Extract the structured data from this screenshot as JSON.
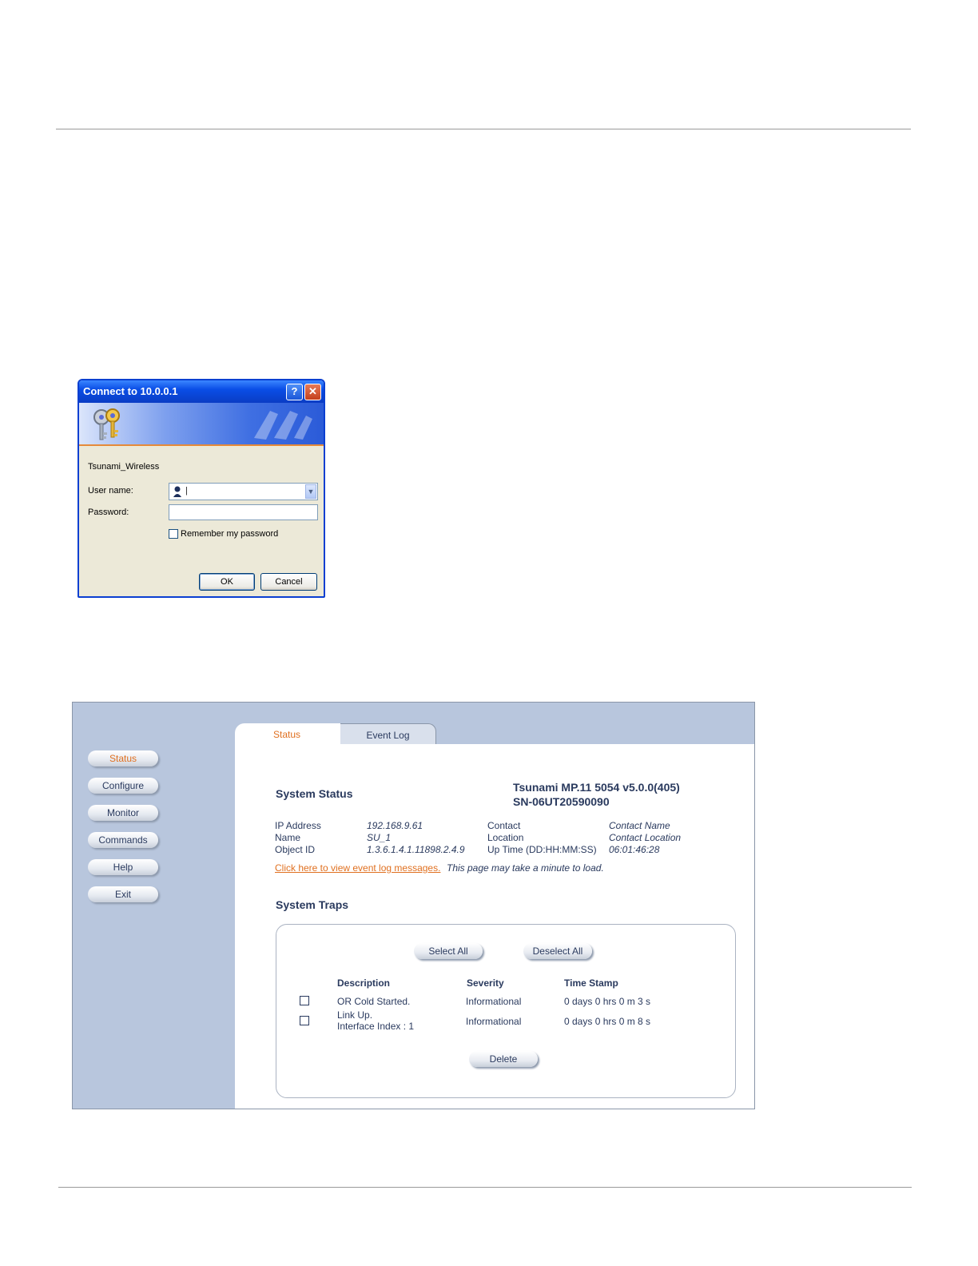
{
  "dialog": {
    "title": "Connect to 10.0.0.1",
    "realm": "Tsunami_Wireless",
    "username_label": "User name:",
    "username_value": "|",
    "password_label": "Password:",
    "password_value": "",
    "remember_label": "Remember my password",
    "ok_label": "OK",
    "cancel_label": "Cancel",
    "help_glyph": "?",
    "close_glyph": "✕"
  },
  "web": {
    "tabs": [
      {
        "label": "Status",
        "active": true
      },
      {
        "label": "Event Log",
        "active": false
      }
    ],
    "nav": [
      {
        "label": "Status",
        "active": true
      },
      {
        "label": "Configure"
      },
      {
        "label": "Monitor"
      },
      {
        "label": "Commands"
      },
      {
        "label": "Help"
      },
      {
        "label": "Exit"
      }
    ],
    "status": {
      "heading": "System Status",
      "product_line1": "Tsunami MP.11 5054 v5.0.0(405)",
      "product_line2": "SN-06UT20590090",
      "fields": {
        "ip_label": "IP Address",
        "ip_value": "192.168.9.61",
        "name_label": "Name",
        "name_value": "SU_1",
        "oid_label": "Object ID",
        "oid_value": "1.3.6.1.4.1.11898.2.4.9",
        "contact_label": "Contact",
        "contact_value": "Contact Name",
        "location_label": "Location",
        "location_value": "Contact Location",
        "uptime_label": "Up Time (DD:HH:MM:SS)",
        "uptime_value": "06:01:46:28"
      },
      "eventlog_link": "Click here to view event log messages.",
      "eventlog_note": "This page may take a minute to load."
    },
    "traps": {
      "heading": "System Traps",
      "select_all": "Select All",
      "deselect_all": "Deselect All",
      "columns": [
        "Description",
        "Severity",
        "Time Stamp"
      ],
      "rows": [
        {
          "description": "OR Cold Started.",
          "description2": "",
          "severity": "Informational",
          "timestamp": "0 days 0 hrs 0 m 3 s"
        },
        {
          "description": "Link Up.",
          "description2": "Interface Index : 1",
          "severity": "Informational",
          "timestamp": "0 days 0 hrs 0 m 8 s"
        }
      ],
      "delete_label": "Delete"
    }
  },
  "colors": {
    "accent": "#e07020",
    "nav_bg": "#b8c6dd",
    "text": "#2a3a5e",
    "xp_title": "#0a4ee6"
  }
}
